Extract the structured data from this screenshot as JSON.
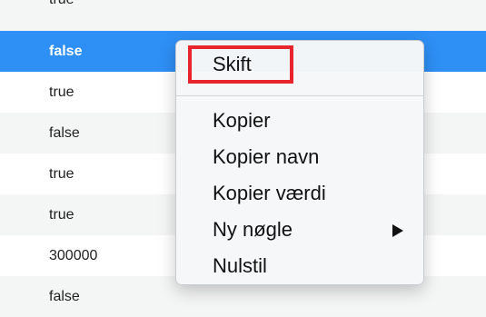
{
  "rows": [
    "true",
    "false",
    "true",
    "false",
    "true",
    "true",
    "300000",
    "false"
  ],
  "menu": {
    "items": [
      "Skift",
      "Kopier",
      "Kopier navn",
      "Kopier værdi",
      "Ny nøgle",
      "Nulstil"
    ],
    "submenu_arrow_icon": "triangle-right-icon"
  },
  "colors": {
    "selection": "#2e8ff5",
    "highlight_box": "#e8242c",
    "row_alt": "#f4f5f5"
  }
}
